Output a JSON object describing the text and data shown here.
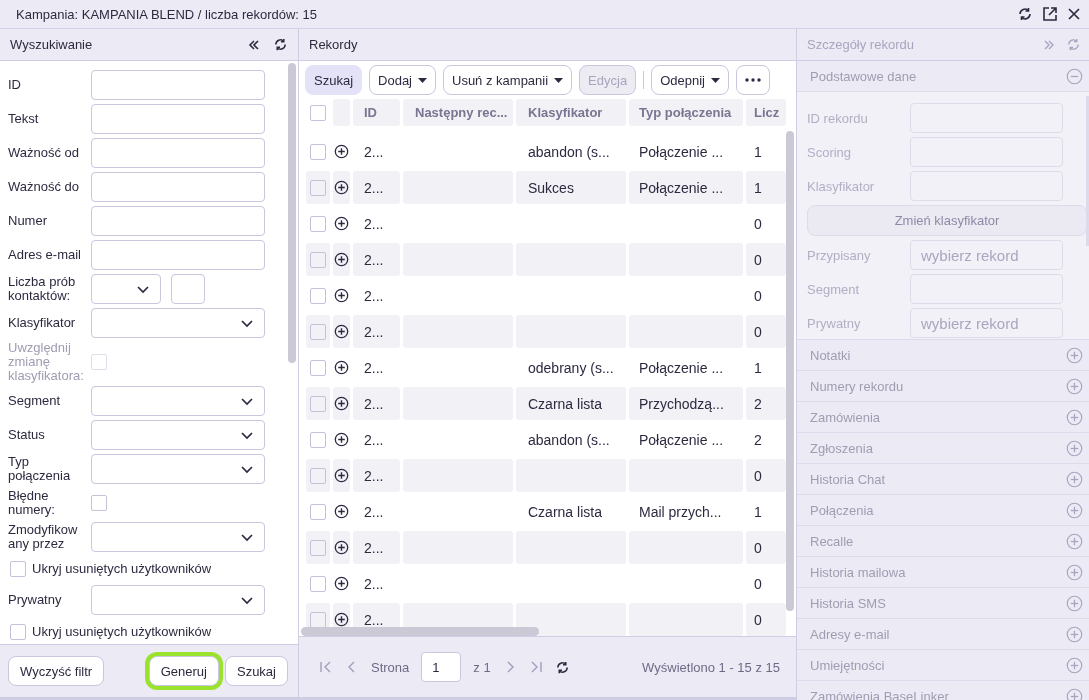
{
  "window": {
    "title": "Kampania: KAMPANIA BLEND / liczba rekordów: 15"
  },
  "search_panel": {
    "title": "Wyszukiwanie",
    "fields": [
      {
        "kind": "text",
        "label": "ID"
      },
      {
        "kind": "text",
        "label": "Tekst"
      },
      {
        "kind": "text",
        "label": "Ważność od"
      },
      {
        "kind": "text",
        "label": "Ważność do"
      },
      {
        "kind": "text",
        "label": "Numer"
      },
      {
        "kind": "text",
        "label": "Adres e-mail"
      },
      {
        "kind": "attempts",
        "label": "Liczba prób kontaktów:"
      },
      {
        "kind": "select",
        "label": "Klasyfikator"
      },
      {
        "kind": "checkbox",
        "label": "Uwzględnij zmianę klasyfikatora:",
        "checked": false,
        "disabled": true
      },
      {
        "kind": "select",
        "label": "Segment"
      },
      {
        "kind": "select",
        "label": "Status"
      },
      {
        "kind": "select",
        "label": "Typ połączenia"
      },
      {
        "kind": "checkbox",
        "label": "Błędne numery:",
        "checked": false,
        "disabled": false
      },
      {
        "kind": "select",
        "label": "Zmodyfikow any przez"
      },
      {
        "kind": "checkbox_row",
        "label": "Ukryj usuniętych użytkowników",
        "checked": false
      },
      {
        "kind": "select",
        "label": "Prywatny"
      },
      {
        "kind": "checkbox_row",
        "label": "Ukryj usuniętych użytkowników",
        "checked": false
      }
    ],
    "buttons": [
      {
        "label": "Wyczyść filtr",
        "highlighted": false
      },
      {
        "label": "Generuj",
        "highlighted": true
      },
      {
        "label": "Szukaj",
        "highlighted": false
      }
    ]
  },
  "records": {
    "title": "Rekordy",
    "toolbar": [
      {
        "kind": "primary",
        "label": "Szukaj",
        "caret": false,
        "disabled": false
      },
      {
        "kind": "default",
        "label": "Dodaj",
        "caret": true,
        "disabled": false
      },
      {
        "kind": "default",
        "label": "Usuń z kampanii",
        "caret": true,
        "disabled": false
      },
      {
        "kind": "default",
        "label": "Edycja",
        "caret": false,
        "disabled": true
      },
      {
        "kind": "separator"
      },
      {
        "kind": "default",
        "label": "Odepnij",
        "caret": true,
        "disabled": false
      },
      {
        "kind": "more"
      }
    ],
    "all_checked": false,
    "columns": [
      "ID",
      "Następny rec...",
      "Klasyfikator",
      "Typ połączenia",
      "Licz"
    ],
    "rows": [
      {
        "checked": false,
        "id": "2...",
        "klasyfikator": "abandon (s...",
        "typ_polaczenia": "Połączenie ...",
        "licz": "1"
      },
      {
        "checked": false,
        "id": "2...",
        "klasyfikator": "Sukces",
        "typ_polaczenia": "Połączenie ...",
        "licz": "1"
      },
      {
        "checked": false,
        "id": "2...",
        "licz": "0"
      },
      {
        "checked": false,
        "id": "2...",
        "licz": "0"
      },
      {
        "checked": false,
        "id": "2...",
        "licz": "0"
      },
      {
        "checked": false,
        "id": "2...",
        "licz": "0"
      },
      {
        "checked": false,
        "id": "2...",
        "klasyfikator": "odebrany (s...",
        "typ_polaczenia": "Połączenie ...",
        "licz": "1"
      },
      {
        "checked": false,
        "id": "2...",
        "klasyfikator": "Czarna lista",
        "typ_polaczenia": "Przychodzą...",
        "licz": "2"
      },
      {
        "checked": false,
        "id": "2...",
        "klasyfikator": "abandon (s...",
        "typ_polaczenia": "Połączenie ...",
        "licz": "2"
      },
      {
        "checked": false,
        "id": "2...",
        "licz": "0"
      },
      {
        "checked": false,
        "id": "2...",
        "klasyfikator": "Czarna lista",
        "typ_polaczenia": "Mail przych...",
        "licz": "1"
      },
      {
        "checked": false,
        "id": "2...",
        "licz": "0"
      },
      {
        "checked": false,
        "id": "2...",
        "licz": "0"
      },
      {
        "checked": false,
        "id": "2...",
        "licz": "0"
      }
    ],
    "pagination": {
      "page_label": "Strona",
      "page": "1",
      "of": "z 1",
      "summary": "Wyświetlono 1 - 15 z 15"
    }
  },
  "details": {
    "title": "Szczegóły rekordu",
    "basic": {
      "title": "Podstawowe dane",
      "expanded": true,
      "fields": [
        {
          "kind": "text",
          "label": "ID rekordu"
        },
        {
          "kind": "text",
          "label": "Scoring"
        },
        {
          "kind": "text",
          "label": "Klasyfikator"
        },
        {
          "kind": "button",
          "label": "Zmień klasyfikator"
        },
        {
          "kind": "text",
          "label": "Przypisany",
          "placeholder": "wybierz rekord"
        },
        {
          "kind": "text",
          "label": "Segment"
        },
        {
          "kind": "text",
          "label": "Prywatny",
          "placeholder": "wybierz rekord"
        }
      ]
    },
    "sections": [
      {
        "title": "Notatki",
        "expanded": false
      },
      {
        "title": "Numery rekordu",
        "expanded": false
      },
      {
        "title": "Zamówienia",
        "expanded": false
      },
      {
        "title": "Zgłoszenia",
        "expanded": false
      },
      {
        "title": "Historia Chat",
        "expanded": false
      },
      {
        "title": "Połączenia",
        "expanded": false
      },
      {
        "title": "Recalle",
        "expanded": false
      },
      {
        "title": "Historia mailowa",
        "expanded": false
      },
      {
        "title": "Historia SMS",
        "expanded": false
      },
      {
        "title": "Adresy e-mail",
        "expanded": false
      },
      {
        "title": "Umiejętności",
        "expanded": false
      },
      {
        "title": "Zamówienia BaseLinker",
        "expanded": false
      }
    ]
  }
}
